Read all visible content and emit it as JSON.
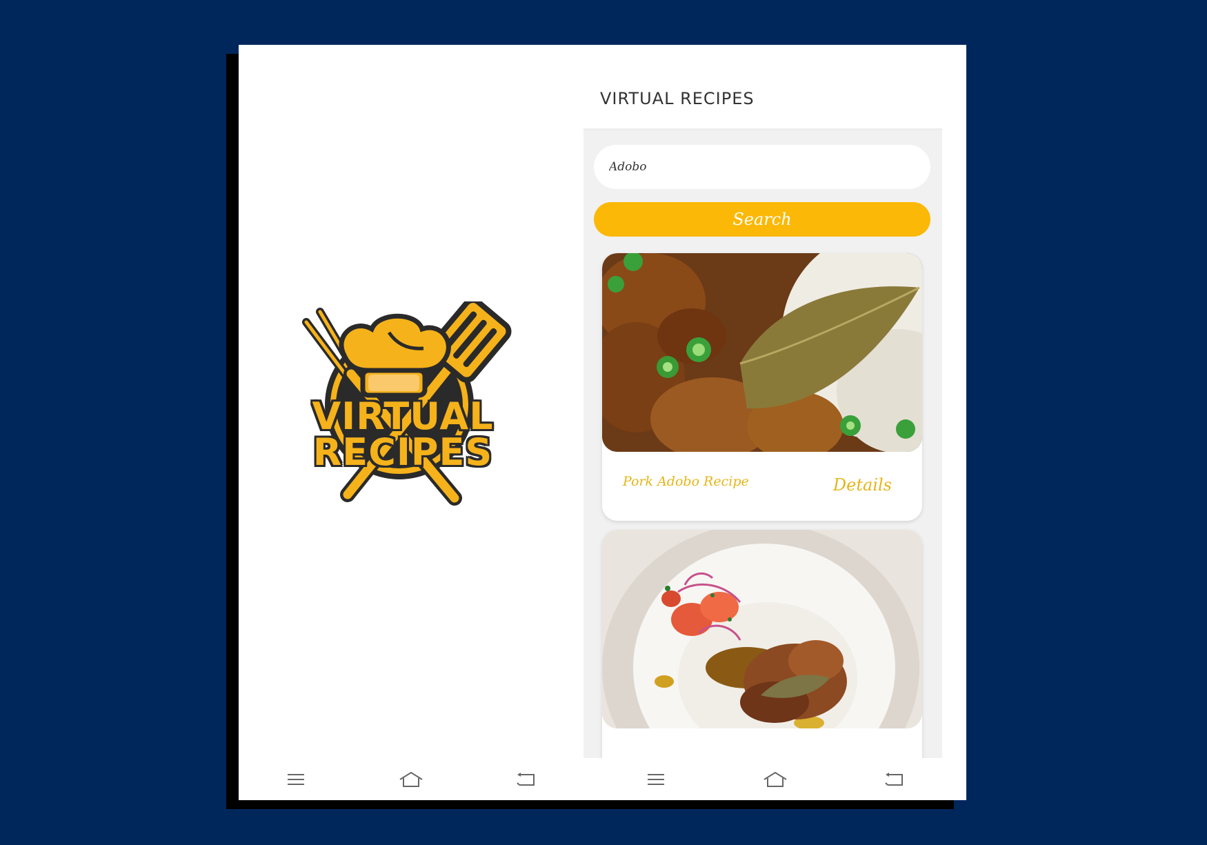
{
  "splash": {
    "logo": {
      "line1": "VIRTUAL",
      "line2": "RECIPES"
    }
  },
  "app": {
    "title": "VIRTUAL RECIPES",
    "search": {
      "value": "Adobo",
      "button_label": "Search"
    },
    "recipes": [
      {
        "title": "Pork Adobo Recipe",
        "details_label": "Details",
        "image": "pork-adobo-photo"
      },
      {
        "title": "",
        "details_label": "",
        "image": "adobo-plate-photo"
      }
    ]
  },
  "navbar": {
    "icons": [
      "menu-icon",
      "home-icon",
      "back-icon"
    ]
  },
  "colors": {
    "background": "#00275c",
    "accent": "#fbb806",
    "card_text": "#e5b518",
    "body_bg": "#f1f1f1"
  }
}
